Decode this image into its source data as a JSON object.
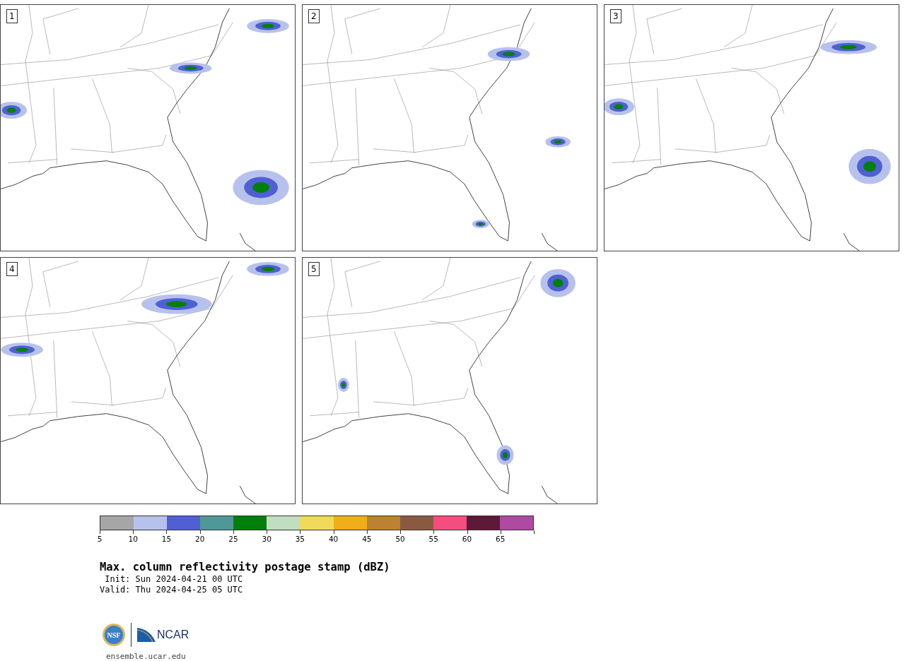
{
  "panels": [
    {
      "label": "1"
    },
    {
      "label": "2"
    },
    {
      "label": "3"
    },
    {
      "label": "4"
    },
    {
      "label": "5"
    }
  ],
  "colorbar": {
    "segments": [
      {
        "color": "#a6a6a6"
      },
      {
        "color": "#b7c2ec"
      },
      {
        "color": "#5060d4"
      },
      {
        "color": "#4f9898"
      },
      {
        "color": "#00800a"
      },
      {
        "color": "#c0dec0"
      },
      {
        "color": "#f0da5a"
      },
      {
        "color": "#f0ae18"
      },
      {
        "color": "#bc8232"
      },
      {
        "color": "#8a5a40"
      },
      {
        "color": "#f44e7e"
      },
      {
        "color": "#5e1838"
      },
      {
        "color": "#ae4aa2"
      }
    ],
    "ticks": [
      "5",
      "10",
      "15",
      "20",
      "25",
      "30",
      "35",
      "40",
      "45",
      "50",
      "55",
      "60",
      "65"
    ]
  },
  "title": "Max. column reflectivity postage stamp (dBZ)",
  "init": " Init: Sun 2024-04-21 00 UTC",
  "valid": "Valid: Thu 2024-04-25 05 UTC",
  "logo": {
    "seal": "NSF",
    "wordmark": "NCAR"
  },
  "footer": "ensemble.ucar.edu"
}
